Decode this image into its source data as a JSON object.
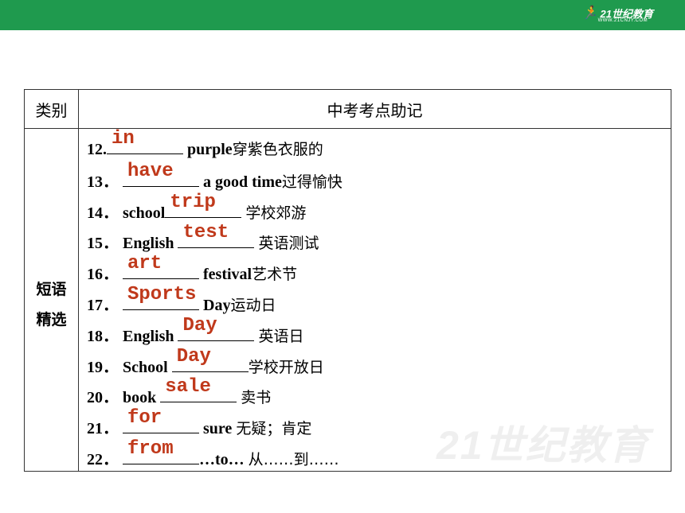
{
  "header": {
    "logo_text": "21世纪教育",
    "logo_sub": "WWW.21CNJY.COM"
  },
  "table": {
    "col_category": "类别",
    "col_main": "中考考点助记",
    "category": [
      "短语",
      "精选"
    ],
    "rows": [
      {
        "num": "12.",
        "pre": "",
        "post": " purple",
        "cn": "穿紫色衣服的",
        "answer": "in"
      },
      {
        "num": "13．",
        "pre": "",
        "post": " a good time",
        "cn": "过得愉快",
        "answer": "have"
      },
      {
        "num": "14．",
        "pre": "school",
        "post": " ",
        "cn": "学校郊游",
        "answer": "trip"
      },
      {
        "num": "15．",
        "pre": "English ",
        "post": " ",
        "cn": "英语测试",
        "answer": "test"
      },
      {
        "num": "16．",
        "pre": "",
        "post": " festival",
        "cn": "艺术节",
        "answer": "art"
      },
      {
        "num": "17．",
        "pre": "",
        "post": " Day",
        "cn": "运动日",
        "answer": "Sports"
      },
      {
        "num": "18．",
        "pre": "English ",
        "post": " ",
        "cn": "英语日",
        "answer": "Day"
      },
      {
        "num": "19．",
        "pre": "School ",
        "post": "",
        "cn": "学校开放日",
        "answer": "Day"
      },
      {
        "num": "20．",
        "pre": "book ",
        "post": " ",
        "cn": "卖书",
        "answer": "sale"
      },
      {
        "num": "21．",
        "pre": "",
        "post": " sure ",
        "cn": "无疑；肯定",
        "answer": "for"
      },
      {
        "num": "22．",
        "pre": "",
        "post": "…to… ",
        "cn": "从……到……",
        "answer": "from"
      }
    ]
  },
  "colors": {
    "topbar": "#1f9a4e",
    "answer": "#c0391b"
  }
}
